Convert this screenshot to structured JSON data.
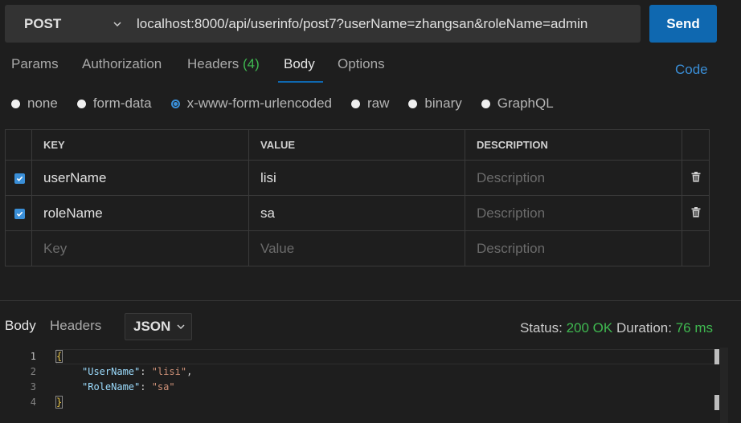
{
  "request": {
    "method": "POST",
    "url": "localhost:8000/api/userinfo/post7?userName=zhangsan&roleName=admin",
    "send_label": "Send"
  },
  "tabs": [
    {
      "label": "Params"
    },
    {
      "label": "Authorization"
    },
    {
      "label": "Headers",
      "count": "(4)"
    },
    {
      "label": "Body",
      "active": true
    },
    {
      "label": "Options"
    }
  ],
  "code_link": "Code",
  "body_types": [
    {
      "label": "none"
    },
    {
      "label": "form-data"
    },
    {
      "label": "x-www-form-urlencoded",
      "selected": true
    },
    {
      "label": "raw"
    },
    {
      "label": "binary"
    },
    {
      "label": "GraphQL"
    }
  ],
  "table": {
    "headers": [
      "KEY",
      "VALUE",
      "DESCRIPTION"
    ],
    "rows": [
      {
        "key": "userName",
        "value": "lisi",
        "description": "Description"
      },
      {
        "key": "roleName",
        "value": "sa",
        "description": "Description"
      }
    ],
    "placeholder": {
      "key": "Key",
      "value": "Value",
      "description": "Description"
    }
  },
  "response": {
    "tabs": [
      "Body",
      "Headers"
    ],
    "format": "JSON",
    "status_label": "Status:",
    "status_value": "200 OK",
    "duration_label": "Duration:",
    "duration_value": "76 ms",
    "line_numbers": [
      "1",
      "2",
      "3",
      "4"
    ],
    "json": {
      "open": "{",
      "k1": "\"UserName\"",
      "v1": "\"lisi\"",
      "k2": "\"RoleName\"",
      "v2": "\"sa\"",
      "close": "}",
      "colon": ": ",
      "comma": ","
    }
  },
  "colors": {
    "accent": "#0f68b0",
    "link": "#3a8fd8",
    "success": "#3fb950",
    "background": "#1e1e1e"
  }
}
